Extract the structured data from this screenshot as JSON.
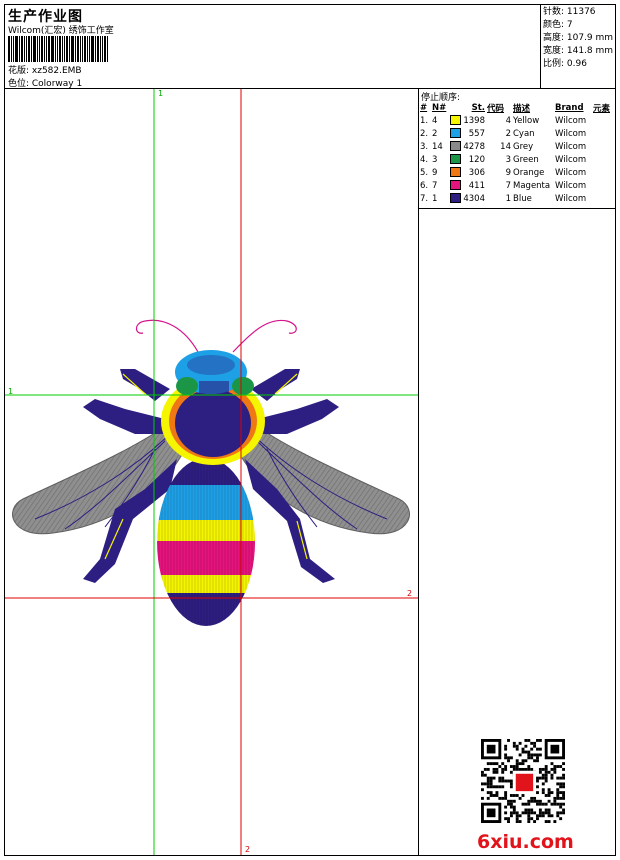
{
  "header": {
    "title": "生产作业图",
    "studio": "Wilcom(汇宏) 绣饰工作室",
    "design_label": "花版: xz582.EMB",
    "colorway_label": "色位:  Colorway 1"
  },
  "stats": {
    "stitches": "针数: 11376",
    "colors": "颜色: 7",
    "height": "高度: 107.9 mm",
    "width": "宽度: 141.8 mm",
    "scale": "比例: 0.96"
  },
  "stop_sequence": {
    "title": "停止顺序:",
    "headers": [
      "#",
      "N#",
      "St.",
      "代码",
      "描述",
      "Brand",
      "元素"
    ],
    "rows": [
      {
        "num": "1.",
        "n": "4",
        "color": "#f5f500",
        "st": "1398",
        "code": "4",
        "desc": "Yellow",
        "brand": "Wilcom"
      },
      {
        "num": "2.",
        "n": "2",
        "color": "#1ea0e6",
        "st": "557",
        "code": "2",
        "desc": "Cyan",
        "brand": "Wilcom"
      },
      {
        "num": "3.",
        "n": "14",
        "color": "#8a8a8a",
        "st": "4278",
        "code": "14",
        "desc": "Grey",
        "brand": "Wilcom"
      },
      {
        "num": "4.",
        "n": "3",
        "color": "#1a9646",
        "st": "120",
        "code": "3",
        "desc": "Green",
        "brand": "Wilcom"
      },
      {
        "num": "5.",
        "n": "9",
        "color": "#f07814",
        "st": "306",
        "code": "9",
        "desc": "Orange",
        "brand": "Wilcom"
      },
      {
        "num": "6.",
        "n": "7",
        "color": "#e6147d",
        "st": "411",
        "code": "7",
        "desc": "Magenta",
        "brand": "Wilcom"
      },
      {
        "num": "7.",
        "n": "1",
        "color": "#2d1e82",
        "st": "4304",
        "code": "1",
        "desc": "Blue",
        "brand": "Wilcom"
      }
    ]
  },
  "guides": {
    "v1_label": "1",
    "h1_label": "1",
    "h2_label": "2",
    "v2_label": "2",
    "green": "#00cc00",
    "red": "#e00000"
  },
  "watermark": {
    "text": "6xiu.com",
    "color": "#e1141c"
  }
}
